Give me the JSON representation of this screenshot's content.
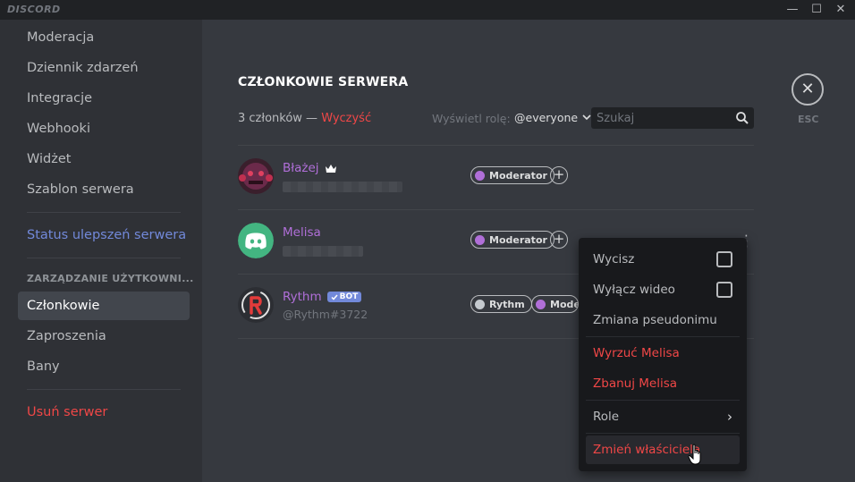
{
  "titlebar": {
    "logo": "DISCORD",
    "minimize": "—",
    "maximize": "☐",
    "close": "✕"
  },
  "sidebar": {
    "items_top": [
      "Moderacja",
      "Dziennik zdarzeń",
      "Integracje",
      "Webhooki",
      "Widżet",
      "Szablon serwera"
    ],
    "boost_status": "Status ulepszeń serwera",
    "user_mgmt_header": "ZARZĄDZANIE UŻYTKOWNI...",
    "members": "Członkowie",
    "invites": "Zaproszenia",
    "bans": "Bany",
    "delete_server": "Usuń serwer"
  },
  "main": {
    "title": "CZŁONKOWIE SERWERA",
    "count_text": "3 członków —",
    "clear": "Wyczyść",
    "role_filter_label": "Wyświetl rolę:",
    "role_filter_value": "@everyone",
    "search_placeholder": "Szukaj",
    "esc_label": "ESC"
  },
  "members": [
    {
      "name": "Błażej",
      "owner_icon": "crown-icon",
      "roles": [
        {
          "label": "Moderator",
          "color": "#b06fd8"
        }
      ]
    },
    {
      "name": "Melisa",
      "roles": [
        {
          "label": "Moderator",
          "color": "#b06fd8"
        }
      ]
    },
    {
      "name": "Rythm",
      "bot_label": "BOT",
      "tag": "@Rythm#3722",
      "roles": [
        {
          "label": "Rythm",
          "color": "#c4c9ce"
        },
        {
          "label": "Moderator",
          "color": "#b06fd8"
        }
      ]
    }
  ],
  "context_menu": {
    "mute": "Wycisz",
    "disable_video": "Wyłącz wideo",
    "change_nickname": "Zmiana pseudonimu",
    "kick": "Wyrzuć Melisa",
    "ban": "Zbanuj Melisa",
    "roles": "Role",
    "transfer_ownership": "Zmień właściciela"
  },
  "colors": {
    "accent": "#7289da",
    "danger": "#f04747",
    "moderator": "#b06fd8",
    "background": "#36393f",
    "sidebar": "#2f3136"
  }
}
